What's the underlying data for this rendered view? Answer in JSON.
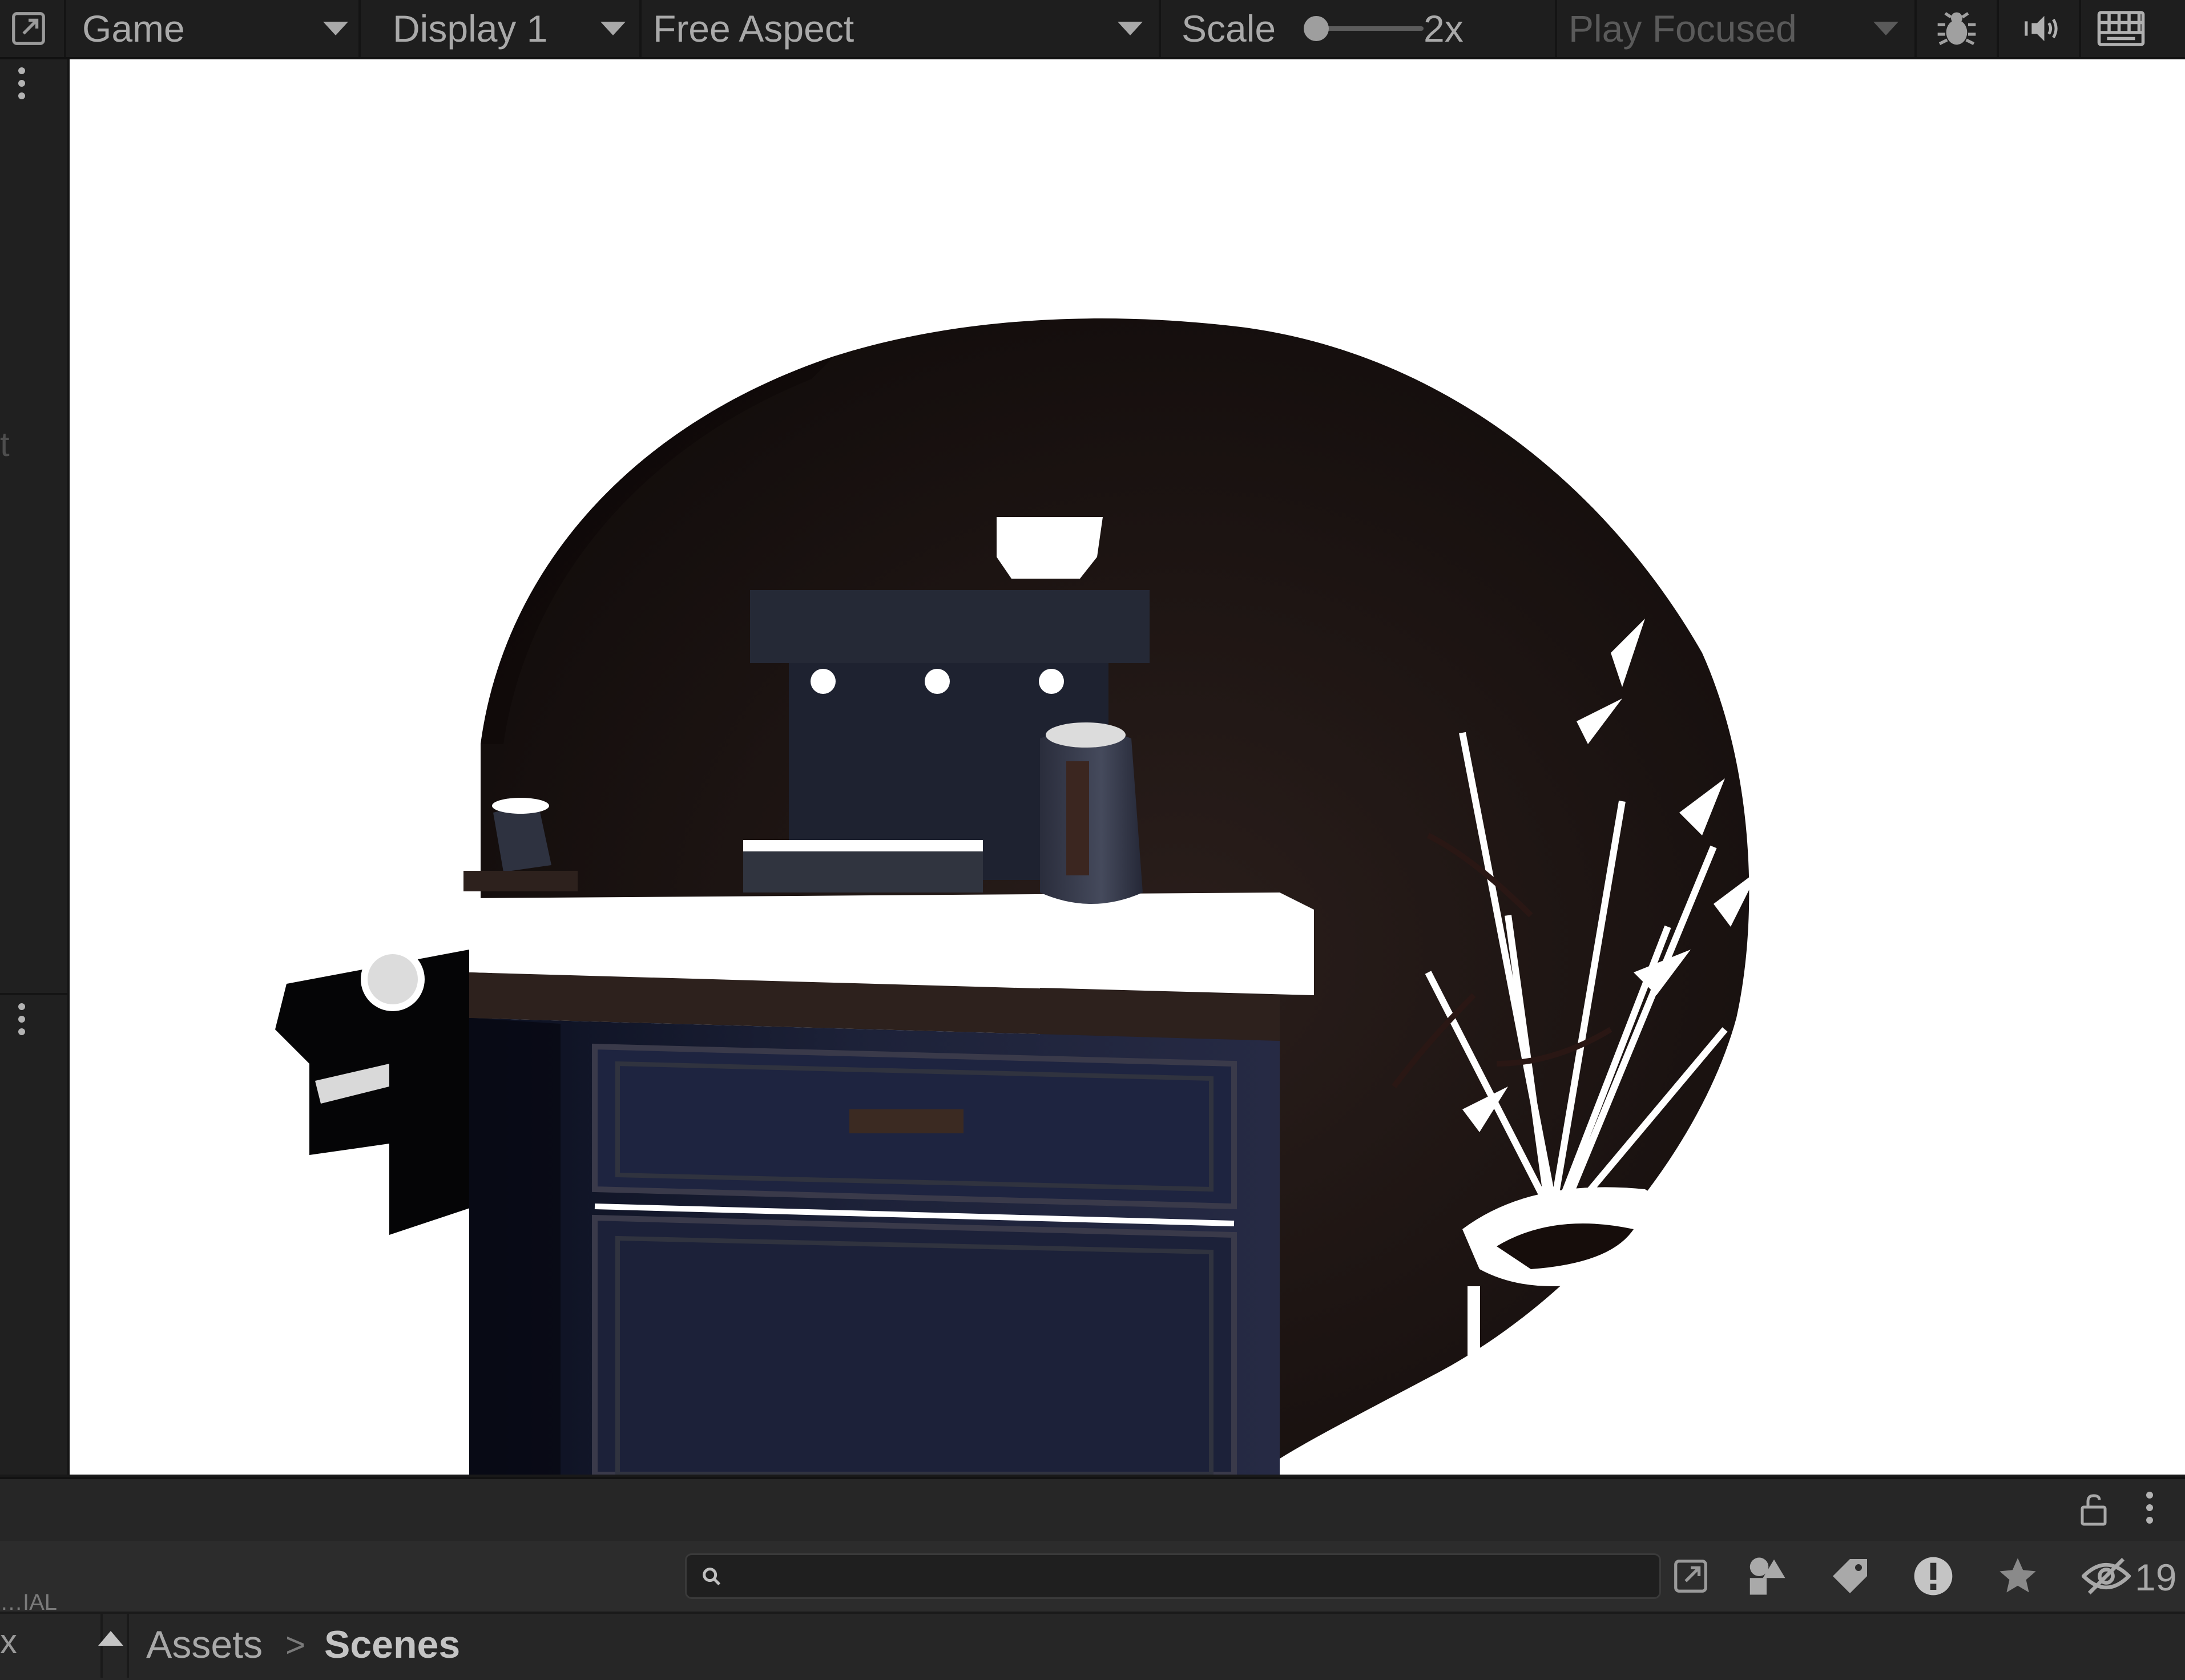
{
  "toolbar": {
    "view_label": "Game",
    "display_label": "Display 1",
    "aspect_label": "Free Aspect",
    "scale_label": "Scale",
    "scale_value": "2x",
    "play_mode_label": "Play Focused"
  },
  "left_panel": {
    "clipped_text": "t"
  },
  "project": {
    "search_value": "",
    "hidden_count": "19",
    "clipped_left_text": "…IAL",
    "clipped_left_symbol": "x"
  },
  "breadcrumb": {
    "items": [
      "Assets",
      "Scenes"
    ],
    "separator": ">"
  },
  "icons": {
    "maximize": "maximize-window-icon",
    "debug": "bug-icon",
    "audio": "speaker-icon",
    "keyboard": "keyboard-icon",
    "lock": "lock-icon",
    "search": "search-icon",
    "filter_type": "shapes-icon",
    "label": "tag-icon",
    "issues": "warning-icon",
    "favorite": "star-icon",
    "hidden": "eye-slash-icon"
  }
}
